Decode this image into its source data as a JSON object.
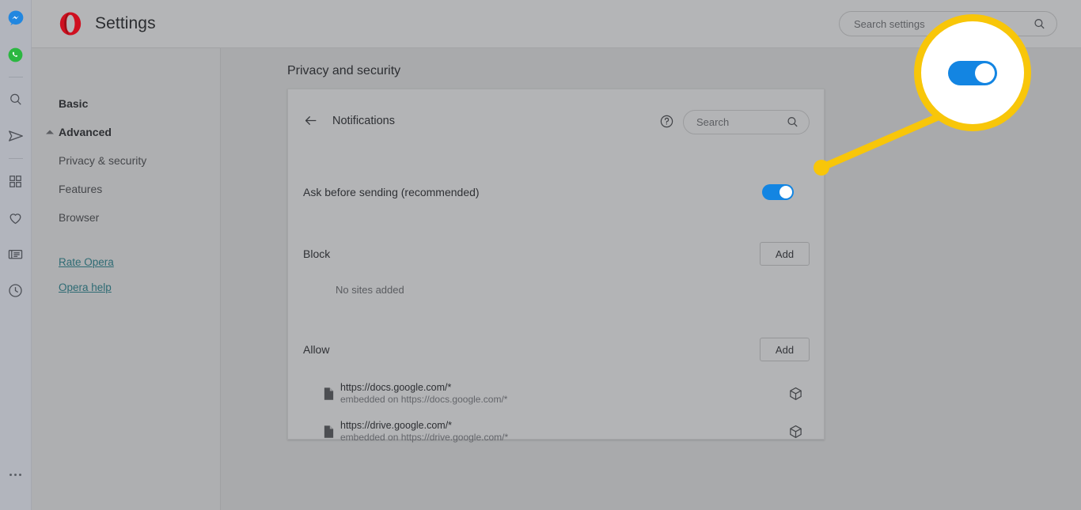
{
  "window": {
    "app_title": "Settings",
    "logo_icon": "opera-logo",
    "background_color": "#a9aaac"
  },
  "rail": {
    "items": [
      {
        "icon": "messenger-icon",
        "label": "Messenger",
        "color": "#1f8df5"
      },
      {
        "icon": "whatsapp-icon",
        "label": "WhatsApp",
        "color": "#25d366"
      },
      {
        "icon": "divider",
        "label": ""
      },
      {
        "icon": "search-icon",
        "label": "Search"
      },
      {
        "icon": "telegram-send-icon",
        "label": "Telegram"
      },
      {
        "icon": "divider",
        "label": ""
      },
      {
        "icon": "apps-grid-icon",
        "label": "Speed dial"
      },
      {
        "icon": "heart-icon",
        "label": "Favorites"
      },
      {
        "icon": "news-card-icon",
        "label": "News"
      },
      {
        "icon": "clock-history-icon",
        "label": "History"
      }
    ],
    "overflow_icon": "more-dots-icon"
  },
  "header": {
    "search": {
      "placeholder": "Search settings",
      "value": "",
      "icon": "search-icon"
    }
  },
  "sidebar": {
    "items": [
      {
        "label": "Basic",
        "level": "top",
        "expanded": false
      },
      {
        "label": "Advanced",
        "level": "top",
        "expanded": true,
        "icon": "caret-up-icon"
      },
      {
        "label": "Privacy & security",
        "level": "sub"
      },
      {
        "label": "Features",
        "level": "sub"
      },
      {
        "label": "Browser",
        "level": "sub"
      }
    ],
    "links": [
      {
        "label": "Rate Opera"
      },
      {
        "label": "Opera help"
      }
    ]
  },
  "main": {
    "page_title": "Privacy and security",
    "card": {
      "back_icon": "back-arrow-icon",
      "title": "Notifications",
      "help_icon": "help-circle-icon",
      "search": {
        "placeholder": "Search",
        "value": "",
        "icon": "search-icon"
      },
      "ask_before_sending": {
        "label": "Ask before sending (recommended)",
        "toggle_on": true,
        "toggle_color": "#1385e2"
      },
      "block": {
        "label": "Block",
        "add_label": "Add",
        "empty_text": "No sites added",
        "sites": []
      },
      "allow": {
        "label": "Allow",
        "add_label": "Add",
        "sites": [
          {
            "icon": "document-icon",
            "url": "https://docs.google.com/*",
            "embedded": "embedded on https://docs.google.com/*",
            "trailing_icon": "cube-icon"
          },
          {
            "icon": "document-icon",
            "url": "https://drive.google.com/*",
            "embedded": "embedded on https://drive.google.com/*",
            "trailing_icon": "cube-icon"
          }
        ]
      }
    }
  },
  "callout": {
    "highlight_color": "#f8c609",
    "circle_icon": "magnifier-callout",
    "zoomed_element": "toggle-switch",
    "zoomed_toggle_on": true
  }
}
